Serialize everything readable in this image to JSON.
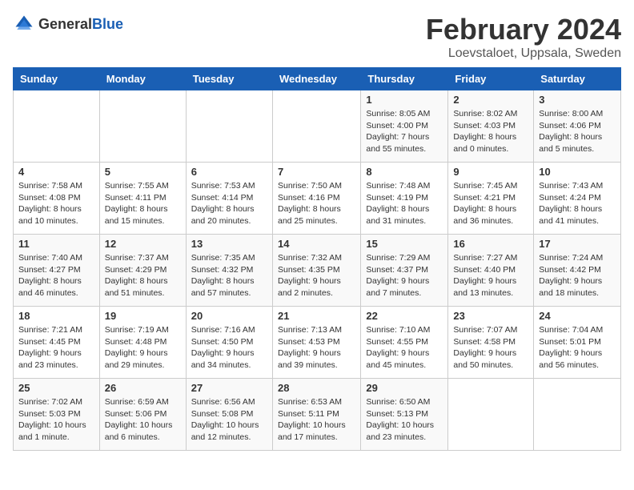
{
  "logo": {
    "text_general": "General",
    "text_blue": "Blue"
  },
  "title": "February 2024",
  "location": "Loevstaloet, Uppsala, Sweden",
  "weekdays": [
    "Sunday",
    "Monday",
    "Tuesday",
    "Wednesday",
    "Thursday",
    "Friday",
    "Saturday"
  ],
  "weeks": [
    [
      {
        "day": "",
        "info": ""
      },
      {
        "day": "",
        "info": ""
      },
      {
        "day": "",
        "info": ""
      },
      {
        "day": "",
        "info": ""
      },
      {
        "day": "1",
        "info": "Sunrise: 8:05 AM\nSunset: 4:00 PM\nDaylight: 7 hours\nand 55 minutes."
      },
      {
        "day": "2",
        "info": "Sunrise: 8:02 AM\nSunset: 4:03 PM\nDaylight: 8 hours\nand 0 minutes."
      },
      {
        "day": "3",
        "info": "Sunrise: 8:00 AM\nSunset: 4:06 PM\nDaylight: 8 hours\nand 5 minutes."
      }
    ],
    [
      {
        "day": "4",
        "info": "Sunrise: 7:58 AM\nSunset: 4:08 PM\nDaylight: 8 hours\nand 10 minutes."
      },
      {
        "day": "5",
        "info": "Sunrise: 7:55 AM\nSunset: 4:11 PM\nDaylight: 8 hours\nand 15 minutes."
      },
      {
        "day": "6",
        "info": "Sunrise: 7:53 AM\nSunset: 4:14 PM\nDaylight: 8 hours\nand 20 minutes."
      },
      {
        "day": "7",
        "info": "Sunrise: 7:50 AM\nSunset: 4:16 PM\nDaylight: 8 hours\nand 25 minutes."
      },
      {
        "day": "8",
        "info": "Sunrise: 7:48 AM\nSunset: 4:19 PM\nDaylight: 8 hours\nand 31 minutes."
      },
      {
        "day": "9",
        "info": "Sunrise: 7:45 AM\nSunset: 4:21 PM\nDaylight: 8 hours\nand 36 minutes."
      },
      {
        "day": "10",
        "info": "Sunrise: 7:43 AM\nSunset: 4:24 PM\nDaylight: 8 hours\nand 41 minutes."
      }
    ],
    [
      {
        "day": "11",
        "info": "Sunrise: 7:40 AM\nSunset: 4:27 PM\nDaylight: 8 hours\nand 46 minutes."
      },
      {
        "day": "12",
        "info": "Sunrise: 7:37 AM\nSunset: 4:29 PM\nDaylight: 8 hours\nand 51 minutes."
      },
      {
        "day": "13",
        "info": "Sunrise: 7:35 AM\nSunset: 4:32 PM\nDaylight: 8 hours\nand 57 minutes."
      },
      {
        "day": "14",
        "info": "Sunrise: 7:32 AM\nSunset: 4:35 PM\nDaylight: 9 hours\nand 2 minutes."
      },
      {
        "day": "15",
        "info": "Sunrise: 7:29 AM\nSunset: 4:37 PM\nDaylight: 9 hours\nand 7 minutes."
      },
      {
        "day": "16",
        "info": "Sunrise: 7:27 AM\nSunset: 4:40 PM\nDaylight: 9 hours\nand 13 minutes."
      },
      {
        "day": "17",
        "info": "Sunrise: 7:24 AM\nSunset: 4:42 PM\nDaylight: 9 hours\nand 18 minutes."
      }
    ],
    [
      {
        "day": "18",
        "info": "Sunrise: 7:21 AM\nSunset: 4:45 PM\nDaylight: 9 hours\nand 23 minutes."
      },
      {
        "day": "19",
        "info": "Sunrise: 7:19 AM\nSunset: 4:48 PM\nDaylight: 9 hours\nand 29 minutes."
      },
      {
        "day": "20",
        "info": "Sunrise: 7:16 AM\nSunset: 4:50 PM\nDaylight: 9 hours\nand 34 minutes."
      },
      {
        "day": "21",
        "info": "Sunrise: 7:13 AM\nSunset: 4:53 PM\nDaylight: 9 hours\nand 39 minutes."
      },
      {
        "day": "22",
        "info": "Sunrise: 7:10 AM\nSunset: 4:55 PM\nDaylight: 9 hours\nand 45 minutes."
      },
      {
        "day": "23",
        "info": "Sunrise: 7:07 AM\nSunset: 4:58 PM\nDaylight: 9 hours\nand 50 minutes."
      },
      {
        "day": "24",
        "info": "Sunrise: 7:04 AM\nSunset: 5:01 PM\nDaylight: 9 hours\nand 56 minutes."
      }
    ],
    [
      {
        "day": "25",
        "info": "Sunrise: 7:02 AM\nSunset: 5:03 PM\nDaylight: 10 hours\nand 1 minute."
      },
      {
        "day": "26",
        "info": "Sunrise: 6:59 AM\nSunset: 5:06 PM\nDaylight: 10 hours\nand 6 minutes."
      },
      {
        "day": "27",
        "info": "Sunrise: 6:56 AM\nSunset: 5:08 PM\nDaylight: 10 hours\nand 12 minutes."
      },
      {
        "day": "28",
        "info": "Sunrise: 6:53 AM\nSunset: 5:11 PM\nDaylight: 10 hours\nand 17 minutes."
      },
      {
        "day": "29",
        "info": "Sunrise: 6:50 AM\nSunset: 5:13 PM\nDaylight: 10 hours\nand 23 minutes."
      },
      {
        "day": "",
        "info": ""
      },
      {
        "day": "",
        "info": ""
      }
    ]
  ]
}
